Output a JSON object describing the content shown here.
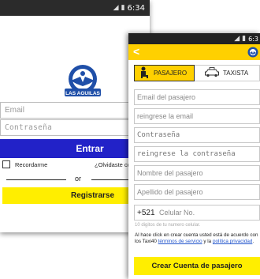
{
  "login": {
    "status_time": "6:34",
    "logo_text": "LAS AGUILAS",
    "email_placeholder": "Email",
    "password_placeholder": "Contraseña",
    "login_button": "Entrar",
    "remember_label": "Recordarme",
    "forgot_link": "¿Olvidaste contra",
    "or_text": "or",
    "register_button": "Registrarse"
  },
  "register": {
    "status_time": "6:3",
    "tabs": [
      {
        "label": "PASAJERO",
        "selected": true
      },
      {
        "label": "TAXISTA",
        "selected": false
      }
    ],
    "fields": [
      "Email del pasajero",
      "reingrese la email",
      "Contraseña",
      "reingrese la contraseña",
      "Nombre del pasajero",
      "Apellido del pasajero"
    ],
    "phone_prefix": "+521",
    "phone_placeholder": "Celular No.",
    "phone_helper": "10 digitos de tu numero celular.",
    "terms_prefix": "Al hace click en crear cuenta usted está de acuerdo con los Taxi40 ",
    "terms_link": "términos de servicio",
    "terms_mid": " y la ",
    "privacy_link": "política privacidad",
    "terms_end": ".",
    "create_button": "Crear Cuenta de pasajero"
  },
  "colors": {
    "login_blue": "#2222c8",
    "yellow": "#ffee00",
    "appbar_yellow": "#ffd000",
    "logo_blue": "#1f4fa8"
  },
  "icons": {
    "wifi": "wifi-icon",
    "signal": "signal-icon",
    "battery": "battery-icon",
    "back": "chevron-left-icon",
    "passenger": "passenger-icon",
    "taxi": "taxi-icon",
    "logo": "eagle-logo-icon"
  }
}
